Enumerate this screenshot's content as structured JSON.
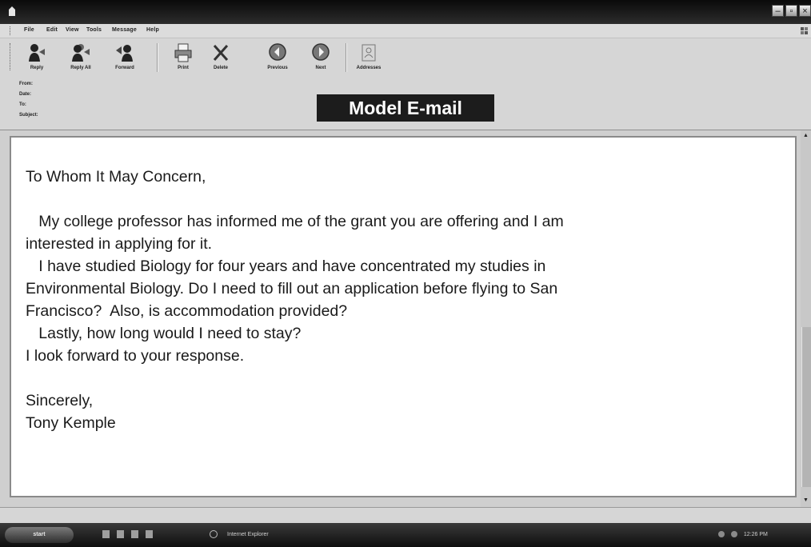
{
  "window": {
    "buttons": [
      "–",
      "▫",
      "×"
    ]
  },
  "menu": [
    "File",
    "Edit",
    "View",
    "Tools",
    "Message",
    "Help"
  ],
  "toolbar": [
    {
      "label": "Reply",
      "icon": "reply-icon"
    },
    {
      "label": "Reply All",
      "icon": "reply-all-icon"
    },
    {
      "label": "Forward",
      "icon": "forward-icon"
    },
    {
      "label": "Print",
      "icon": "print-icon"
    },
    {
      "label": "Delete",
      "icon": "delete-icon"
    },
    {
      "label": "Previous",
      "icon": "previous-icon"
    },
    {
      "label": "Next",
      "icon": "next-icon"
    },
    {
      "label": "Addresses",
      "icon": "addresses-icon"
    }
  ],
  "headers": {
    "labels": [
      "From:",
      "Date:",
      "To:",
      "Subject:"
    ]
  },
  "banner": "Model E-mail",
  "message": {
    "greeting": "To Whom It May Concern,",
    "lines": [
      "   My college professor has informed me of the grant you are offering and I am",
      "interested in applying for it.",
      "   I have studied Biology for four years and have concentrated my studies in",
      "Environmental Biology. Do I need to fill out an application before flying to San",
      "Francisco?  Also, is accommodation provided?",
      "   Lastly, how long would I need to stay?",
      "I look forward to your response."
    ],
    "closing": "Sincerely,",
    "signature": "Tony Kemple"
  },
  "taskbar": {
    "start_label": "start",
    "app_label": "Internet Explorer",
    "clock": "12:26 PM"
  }
}
